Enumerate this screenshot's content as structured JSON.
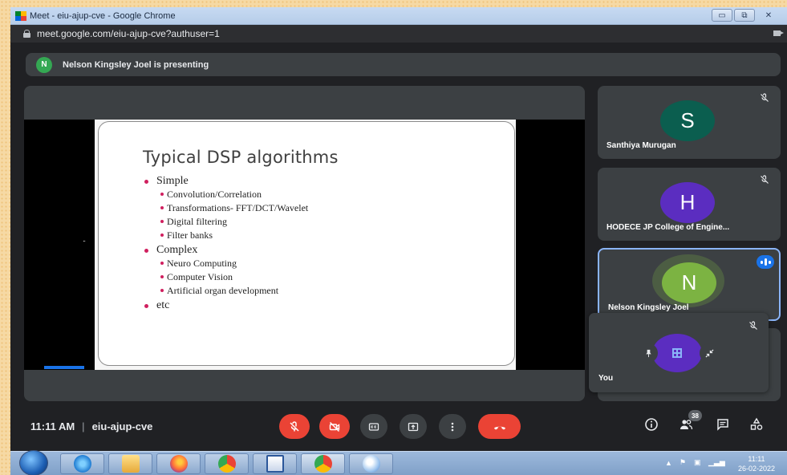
{
  "window": {
    "title": "Meet - eiu-ajup-cve - Google Chrome",
    "url": "meet.google.com/eiu-ajup-cve?authuser=1"
  },
  "presenting_banner": {
    "initial": "N",
    "text": "Nelson Kingsley Joel is presenting"
  },
  "slide": {
    "title": "Typical DSP algorithms",
    "items": [
      {
        "level": 1,
        "text": "Simple"
      },
      {
        "level": 2,
        "text": "Convolution/Correlation"
      },
      {
        "level": 2,
        "text": "Transformations- FFT/DCT/Wavelet"
      },
      {
        "level": 2,
        "text": "Digital filtering"
      },
      {
        "level": 2,
        "text": "Filter banks"
      },
      {
        "level": 1,
        "text": "Complex"
      },
      {
        "level": 2,
        "text": "Neuro Computing"
      },
      {
        "level": 2,
        "text": "Computer Vision"
      },
      {
        "level": 2,
        "text": "Artificial organ development"
      },
      {
        "level": 1,
        "text": "etc"
      }
    ]
  },
  "participants": [
    {
      "initial": "S",
      "name": "Santhiya Murugan",
      "color": "#0b5e4f",
      "muted": true
    },
    {
      "initial": "H",
      "name": "HODECE JP College of Engine...",
      "color": "#5b2dc0",
      "muted": true
    },
    {
      "initial": "N",
      "name": "Nelson Kingsley Joel",
      "color": "#7cb342",
      "speaking": true
    }
  ],
  "self_tile": {
    "name": "You"
  },
  "bottom_bar": {
    "time": "11:11 AM",
    "meeting_code": "eiu-ajup-cve",
    "participant_count": "38"
  },
  "taskbar": {
    "clock_time": "11:11",
    "clock_date": "26-02-2022"
  },
  "colors": {
    "meet_bg": "#202124",
    "tile_bg": "#3c4043",
    "leave_red": "#ea4335",
    "active_blue": "#8ab4f8"
  }
}
